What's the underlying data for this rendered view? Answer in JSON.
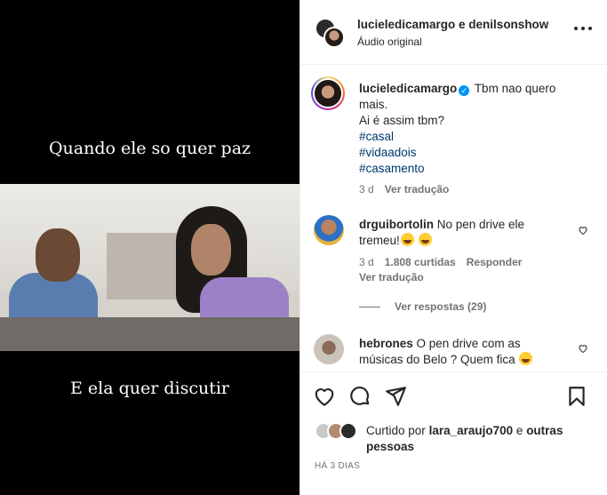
{
  "media": {
    "caption_top": "Quando ele so quer paz",
    "caption_bottom": "E ela quer discutir"
  },
  "header": {
    "title": "lucieledicamargo e denilsonshow",
    "subtitle": "Áudio original",
    "more_icon": "more-horizontal-icon"
  },
  "post": {
    "username": "lucieledicamargo",
    "text_line1": "Tbm nao quero",
    "text_line2": "mais.",
    "text_line3": "Ai é assim tbm?",
    "hashtags": [
      "#casal",
      "#vidaadois",
      "#casamento"
    ],
    "age": "3 d",
    "translate": "Ver tradução"
  },
  "comments": [
    {
      "username": "drguibortolin",
      "text_line1": "No pen drive ele",
      "text_line2": "tremeu!",
      "age": "3 d",
      "likes": "1.808 curtidas",
      "reply": "Responder",
      "translate": "Ver tradução",
      "view_replies": "Ver respostas (29)"
    },
    {
      "username": "hebrones",
      "text_line1": "O pen drive com as",
      "text_line2": "músicas do Belo ? Quem fica"
    }
  ],
  "actions": {
    "like_icon": "heart-icon",
    "comment_icon": "comment-icon",
    "share_icon": "send-icon",
    "save_icon": "bookmark-icon"
  },
  "likes": {
    "prefix": "Curtido por",
    "user": "lara_araujo700",
    "joiner": "e",
    "rest": "outras pessoas"
  },
  "timestamp": "HÁ 3 DIAS"
}
